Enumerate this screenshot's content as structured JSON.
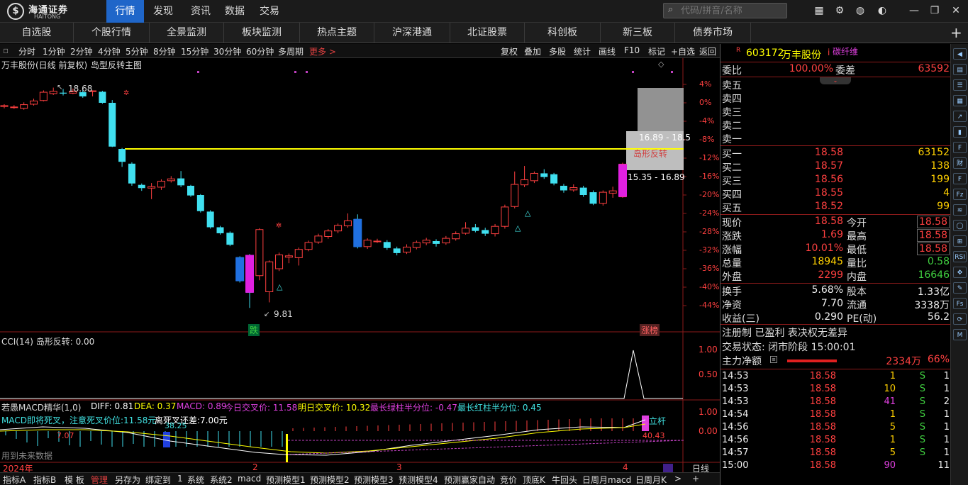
{
  "app": {
    "logo_name": "海通证券",
    "logo_sub": "HAITONG",
    "top_nav": [
      "行情",
      "发现",
      "资讯",
      "数据",
      "交易"
    ],
    "search_placeholder": "代码/拼音/名称",
    "top_icons": [
      "grid-icon",
      "gear-icon",
      "globe-icon",
      "chat-icon",
      "minimize-icon",
      "maximize-icon",
      "close-icon"
    ]
  },
  "nav2": [
    "自选股",
    "个股行情",
    "全景监测",
    "板块监测",
    "热点主题",
    "沪深港通",
    "北证股票",
    "科创板",
    "新三板",
    "债券市场"
  ],
  "periods": [
    "分时",
    "1分钟",
    "2分钟",
    "4分钟",
    "5分钟",
    "8分钟",
    "15分钟",
    "30分钟",
    "60分钟",
    "多周期",
    "更多 >"
  ],
  "tools": [
    "复权",
    "叠加",
    "多股",
    "统计",
    "画线",
    "F10",
    "标记",
    "+自选",
    "返回"
  ],
  "chart": {
    "title": "万丰股份(日线 前复权)",
    "indicator": "岛型反转主图",
    "high_label": "18.68",
    "low_label": "9.81",
    "gap_top": "16.89 - 18.5",
    "island_label": "岛形反转",
    "gap_bottom": "15.35 - 16.89",
    "tag_drop": "跌",
    "tag_limit": "涨榜",
    "cci_title": "CCI(14) 岛形反转: 0.00",
    "macd_title": "若愚MACD精华(1,0)",
    "macd_diff": "DIFF: 0.81",
    "macd_dea": "DEA: 0.37",
    "macd_macd": "MACD: 0.89",
    "macd_today": "今日交叉价: 11.58",
    "macd_tomorrow": "明日交叉价: 10.32",
    "macd_green": "最长绿柱半分位: -0.47",
    "macd_red": "最长红柱半分位: 0.45",
    "macd_warn": "MACD即将死叉，注意死叉价位:11.58元",
    "macd_gap": "离死叉还差:7.00元",
    "macd_7_07": "7.07",
    "macd_38_25": "38.25",
    "macd_40_43": "40.43",
    "macd_up": "立杆",
    "future_note": "用到未来数据",
    "year_label": "2024年",
    "months": [
      "2",
      "3",
      "4"
    ],
    "period_label": "日线",
    "price_axis": [
      "4%",
      "0%",
      "-4%",
      "-8%",
      "-12%",
      "-16%",
      "-20%",
      "-24%",
      "-28%",
      "-32%",
      "-36%",
      "-40%",
      "-44%"
    ],
    "cci_axis": [
      "1.00",
      "0.50"
    ],
    "macd_axis": [
      "1.00",
      "0.00"
    ]
  },
  "chart_data": {
    "type": "candlestick",
    "title": "万丰股份(日线 前复权)",
    "y_axis": "percent change",
    "ylim": [
      -46,
      6
    ],
    "candles": [
      {
        "o": -0.8,
        "c": -0.6,
        "h": -0.3,
        "l": -1.2
      },
      {
        "o": -1.0,
        "c": -0.9,
        "h": -0.5,
        "l": -1.3
      },
      {
        "o": -1.2,
        "c": -0.4,
        "h": 0.1,
        "l": -1.5
      },
      {
        "o": -0.3,
        "c": 0.4,
        "h": 0.9,
        "l": -0.6
      },
      {
        "o": 0.5,
        "c": 2.3,
        "h": 2.7,
        "l": 0.3
      },
      {
        "o": 2.0,
        "c": 2.5,
        "h": 3.3,
        "l": 1.7
      },
      {
        "o": 2.2,
        "c": 2.0,
        "h": 3.0,
        "l": 1.6
      },
      {
        "o": 2.1,
        "c": 2.4,
        "h": 3.1,
        "l": 1.9
      },
      {
        "o": 2.3,
        "c": 1.4,
        "h": 2.8,
        "l": 1.1
      },
      {
        "o": 2.5,
        "c": 2.6,
        "h": 2.7,
        "l": 1.4
      },
      {
        "o": 2.4,
        "c": 0.0,
        "h": 2.6,
        "l": -0.2
      },
      {
        "o": 0.0,
        "c": -9.5,
        "h": 0.6,
        "l": -9.6
      },
      {
        "o": -10.0,
        "c": -12.8,
        "h": -9.8,
        "l": -13.9
      },
      {
        "o": -13.2,
        "c": -17.5,
        "h": -12.9,
        "l": -18.0
      },
      {
        "o": -17.8,
        "c": -18.5,
        "h": -17.5,
        "l": -19.1
      },
      {
        "o": -18.5,
        "c": -18.2,
        "h": -17.4,
        "l": -20.9
      },
      {
        "o": -18.3,
        "c": -17.0,
        "h": -16.6,
        "l": -18.9
      },
      {
        "o": -16.9,
        "c": -16.5,
        "h": -15.9,
        "l": -17.3
      },
      {
        "o": -16.4,
        "c": -17.9,
        "h": -14.8,
        "l": -18.3
      },
      {
        "o": -18.0,
        "c": -20.1,
        "h": -17.8,
        "l": -20.4
      },
      {
        "o": -20.0,
        "c": -23.5,
        "h": -19.8,
        "l": -23.8
      },
      {
        "o": -23.6,
        "c": -27.0,
        "h": -23.3,
        "l": -27.3
      },
      {
        "o": -27.0,
        "c": -28.3,
        "h": -26.7,
        "l": -28.6
      },
      {
        "o": -28.2,
        "c": -30.8,
        "h": -27.9,
        "l": -31.1
      },
      {
        "o": -33.5,
        "c": -38.7,
        "h": -33.3,
        "l": -39.0
      },
      {
        "o": -33.0,
        "c": -41.2,
        "h": -32.8,
        "l": -44.5
      },
      {
        "o": -37.5,
        "c": -27.5,
        "h": -27.2,
        "l": -38.5
      },
      {
        "o": -41.0,
        "c": -34.5,
        "h": -34.2,
        "l": -43.3
      },
      {
        "o": -36.0,
        "c": -33.0,
        "h": -32.5,
        "l": -36.5
      },
      {
        "o": -33.5,
        "c": -33.2,
        "h": -32.7,
        "l": -34.8
      },
      {
        "o": -33.6,
        "c": -31.8,
        "h": -31.4,
        "l": -35.3
      },
      {
        "o": -31.8,
        "c": -30.3,
        "h": -29.9,
        "l": -32.2
      },
      {
        "o": -30.2,
        "c": -28.9,
        "h": -28.4,
        "l": -30.6
      },
      {
        "o": -29.0,
        "c": -27.8,
        "h": -27.4,
        "l": -29.5
      },
      {
        "o": -27.8,
        "c": -26.6,
        "h": -26.2,
        "l": -28.3
      },
      {
        "o": -26.7,
        "c": -25.6,
        "h": -24.0,
        "l": -27.1
      },
      {
        "o": -25.2,
        "c": -31.3,
        "h": -24.2,
        "l": -31.6
      },
      {
        "o": -31.2,
        "c": -29.8,
        "h": -29.4,
        "l": -31.7
      },
      {
        "o": -30.0,
        "c": -30.0,
        "h": -29.5,
        "l": -30.4
      },
      {
        "o": -30.2,
        "c": -31.5,
        "h": -29.8,
        "l": -31.9
      },
      {
        "o": -31.6,
        "c": -32.6,
        "h": -31.2,
        "l": -33.1
      },
      {
        "o": -32.4,
        "c": -31.3,
        "h": -30.7,
        "l": -32.8
      },
      {
        "o": -31.4,
        "c": -30.3,
        "h": -29.9,
        "l": -31.8
      },
      {
        "o": -30.4,
        "c": -29.8,
        "h": -29.3,
        "l": -30.9
      },
      {
        "o": -30.0,
        "c": -30.6,
        "h": -29.6,
        "l": -31.2
      },
      {
        "o": -30.4,
        "c": -29.4,
        "h": -28.9,
        "l": -30.8
      },
      {
        "o": -29.5,
        "c": -28.4,
        "h": -27.9,
        "l": -29.9
      },
      {
        "o": -28.3,
        "c": -27.2,
        "h": -25.9,
        "l": -28.6
      },
      {
        "o": -27.0,
        "c": -27.8,
        "h": -26.3,
        "l": -28.1
      },
      {
        "o": -27.6,
        "c": -28.4,
        "h": -27.1,
        "l": -28.9
      },
      {
        "o": -28.4,
        "c": -26.8,
        "h": -26.3,
        "l": -29.0
      },
      {
        "o": -26.8,
        "c": -22.6,
        "h": -22.1,
        "l": -27.3
      },
      {
        "o": -22.5,
        "c": -17.7,
        "h": -14.9,
        "l": -22.9
      },
      {
        "o": -17.8,
        "c": -16.7,
        "h": -13.7,
        "l": -18.3
      },
      {
        "o": -16.9,
        "c": -15.3,
        "h": -14.9,
        "l": -17.4
      },
      {
        "o": -15.3,
        "c": -16.1,
        "h": -14.4,
        "l": -16.5
      },
      {
        "o": -15.5,
        "c": -17.5,
        "h": -15.2,
        "l": -17.9
      },
      {
        "o": -18.0,
        "c": -19.0,
        "h": -17.6,
        "l": -19.5
      },
      {
        "o": -18.9,
        "c": -18.4,
        "h": -17.7,
        "l": -19.3
      },
      {
        "o": -18.4,
        "c": -20.0,
        "h": -18.0,
        "l": -20.4
      },
      {
        "o": -19.4,
        "c": -21.9,
        "h": -19.0,
        "l": -22.2
      },
      {
        "o": -21.8,
        "c": -19.4,
        "h": -19.0,
        "l": -22.3
      },
      {
        "o": -19.6,
        "c": -19.1,
        "h": -18.2,
        "l": -20.6
      },
      {
        "o": -20.4,
        "c": -13.3,
        "h": -13.0,
        "l": -20.6
      }
    ],
    "gap_upper": [
      16.89,
      18.5
    ],
    "gap_lower": [
      15.35,
      16.89
    ],
    "annotations": {
      "high": 18.68,
      "low": 9.81
    }
  },
  "quote": {
    "code": "603172",
    "name": "万丰股份",
    "tag": "碳纤维",
    "weibi_label": "委比",
    "weibi": "100.00%",
    "weicha_label": "委差",
    "weicha": "63592",
    "asks": [
      {
        "label": "卖五",
        "price": "",
        "vol": ""
      },
      {
        "label": "卖四",
        "price": "",
        "vol": ""
      },
      {
        "label": "卖三",
        "price": "",
        "vol": ""
      },
      {
        "label": "卖二",
        "price": "",
        "vol": ""
      },
      {
        "label": "卖一",
        "price": "",
        "vol": ""
      }
    ],
    "bids": [
      {
        "label": "买一",
        "price": "18.58",
        "vol": "63152"
      },
      {
        "label": "买二",
        "price": "18.57",
        "vol": "138"
      },
      {
        "label": "买三",
        "price": "18.56",
        "vol": "199"
      },
      {
        "label": "买四",
        "price": "18.55",
        "vol": "4"
      },
      {
        "label": "买五",
        "price": "18.52",
        "vol": "99"
      }
    ],
    "stats": [
      {
        "l1": "现价",
        "v1": "18.58",
        "l2": "今开",
        "v2": "18.58",
        "c1": "red",
        "c2": "red"
      },
      {
        "l1": "涨跌",
        "v1": "1.69",
        "l2": "最高",
        "v2": "18.58",
        "c1": "red",
        "c2": "red"
      },
      {
        "l1": "涨幅",
        "v1": "10.01%",
        "l2": "最低",
        "v2": "18.58",
        "c1": "red",
        "c2": "red"
      },
      {
        "l1": "总量",
        "v1": "18945",
        "l2": "量比",
        "v2": "0.58",
        "c1": "yellow",
        "c2": "green"
      },
      {
        "l1": "外盘",
        "v1": "2299",
        "l2": "内盘",
        "v2": "16646",
        "c1": "red",
        "c2": "green"
      }
    ],
    "stats2": [
      {
        "l1": "换手",
        "v1": "5.68%",
        "l2": "股本",
        "v2": "1.33亿"
      },
      {
        "l1": "净资",
        "v1": "7.70",
        "l2": "流通",
        "v2": "3338万"
      },
      {
        "l1": "收益(三)",
        "v1": "0.290",
        "l2": "PE(动)",
        "v2": "56.2"
      }
    ],
    "reg": "注册制 已盈利 表决权无差异",
    "trade_state": "交易状态: 闭市阶段 15:00:01",
    "main_label": "主力净额",
    "main_value": "2334万",
    "main_pct": "66%",
    "ticks": [
      {
        "t": "14:53",
        "p": "18.58",
        "v": "1",
        "s": "S",
        "n": "1",
        "vc": "yellow"
      },
      {
        "t": "14:53",
        "p": "18.58",
        "v": "10",
        "s": "S",
        "n": "1",
        "vc": "yellow"
      },
      {
        "t": "14:53",
        "p": "18.58",
        "v": "41",
        "s": "S",
        "n": "2",
        "vc": "magenta"
      },
      {
        "t": "14:54",
        "p": "18.58",
        "v": "1",
        "s": "S",
        "n": "1",
        "vc": "yellow"
      },
      {
        "t": "14:56",
        "p": "18.58",
        "v": "5",
        "s": "S",
        "n": "1",
        "vc": "yellow"
      },
      {
        "t": "14:56",
        "p": "18.58",
        "v": "1",
        "s": "S",
        "n": "1",
        "vc": "yellow"
      },
      {
        "t": "14:57",
        "p": "18.58",
        "v": "5",
        "s": "S",
        "n": "1",
        "vc": "yellow"
      },
      {
        "t": "15:00",
        "p": "18.58",
        "v": "90",
        "s": "",
        "n": "11",
        "vc": "magenta"
      }
    ]
  },
  "bottom_tabs": [
    "指标A",
    "指标B",
    "模 板",
    "管理",
    "另存为",
    "绑定到",
    "1",
    "系统",
    "系统2",
    "macd",
    "预测模型1",
    "预测模型2",
    "预测模型3",
    "预测模型4",
    "预测赢家自动",
    "竞价",
    "顶底K",
    "牛回头",
    "日周月macd",
    "日周月K",
    ">",
    "+"
  ],
  "side_icons": [
    "arrow-left-icon",
    "tile-icon",
    "list-icon",
    "table-icon",
    "chart-icon",
    "candle-icon",
    "f10-icon",
    "fin-icon",
    "f-icon",
    "fz-icon",
    "flow-icon",
    "circle-icon",
    "kline-icon",
    "rsi-icon",
    "arrows-icon",
    "pen-icon",
    "fs-icon",
    "refresh-icon",
    "m-icon"
  ]
}
